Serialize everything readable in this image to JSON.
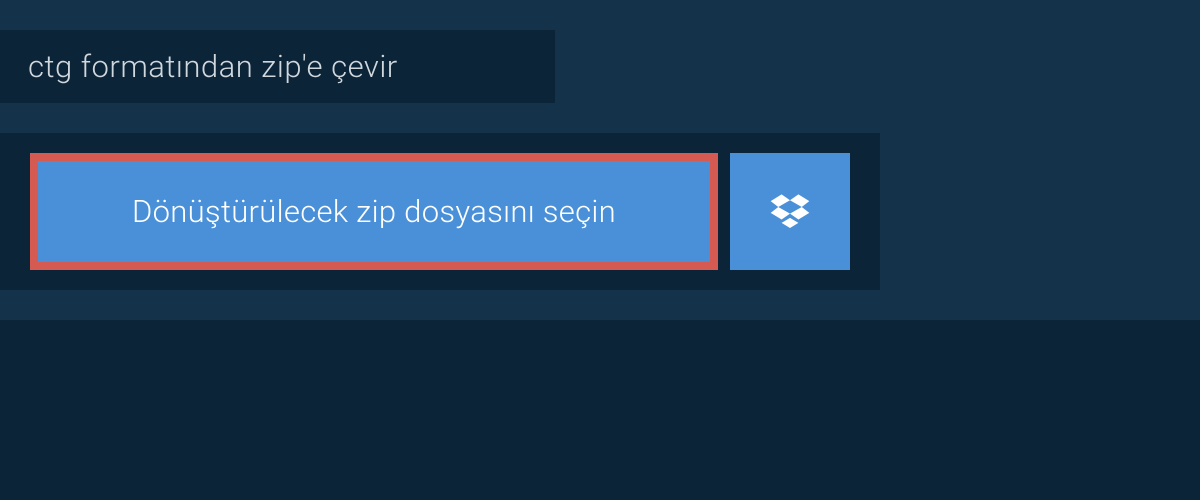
{
  "header": {
    "title": "ctg formatından zip'e çevir"
  },
  "upload": {
    "select_file_label": "Dönüştürülecek zip dosyasını seçin"
  },
  "colors": {
    "background": "#14324a",
    "panel": "#0c2438",
    "button": "#4a90d9",
    "highlight_border": "#d45a52",
    "text_light": "#d0d8de",
    "text_white": "#ffffff"
  }
}
